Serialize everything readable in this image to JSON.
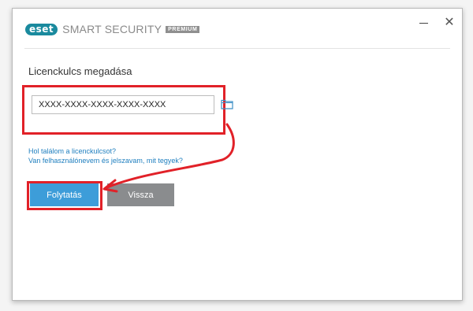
{
  "app": {
    "logo_text": "eset",
    "product_name": "SMART SECURITY",
    "edition_badge": "PREMIUM",
    "close_symbol": "✕"
  },
  "form": {
    "title": "Licenckulcs megadása",
    "license_key_value": "XXXX-XXXX-XXXX-XXXX-XXXX",
    "browse_icon": "folder-icon"
  },
  "links": {
    "find_key": "Hol találom a licenckulcsot?",
    "have_credentials": "Van felhasználónevem és jelszavam, mit tegyek?"
  },
  "buttons": {
    "continue_label": "Folytatás",
    "back_label": "Vissza"
  },
  "colors": {
    "accent": "#3d9dd9",
    "brand": "#1a8a9e",
    "annotation_red": "#e12128",
    "disabled_button": "#8a8c8e"
  }
}
